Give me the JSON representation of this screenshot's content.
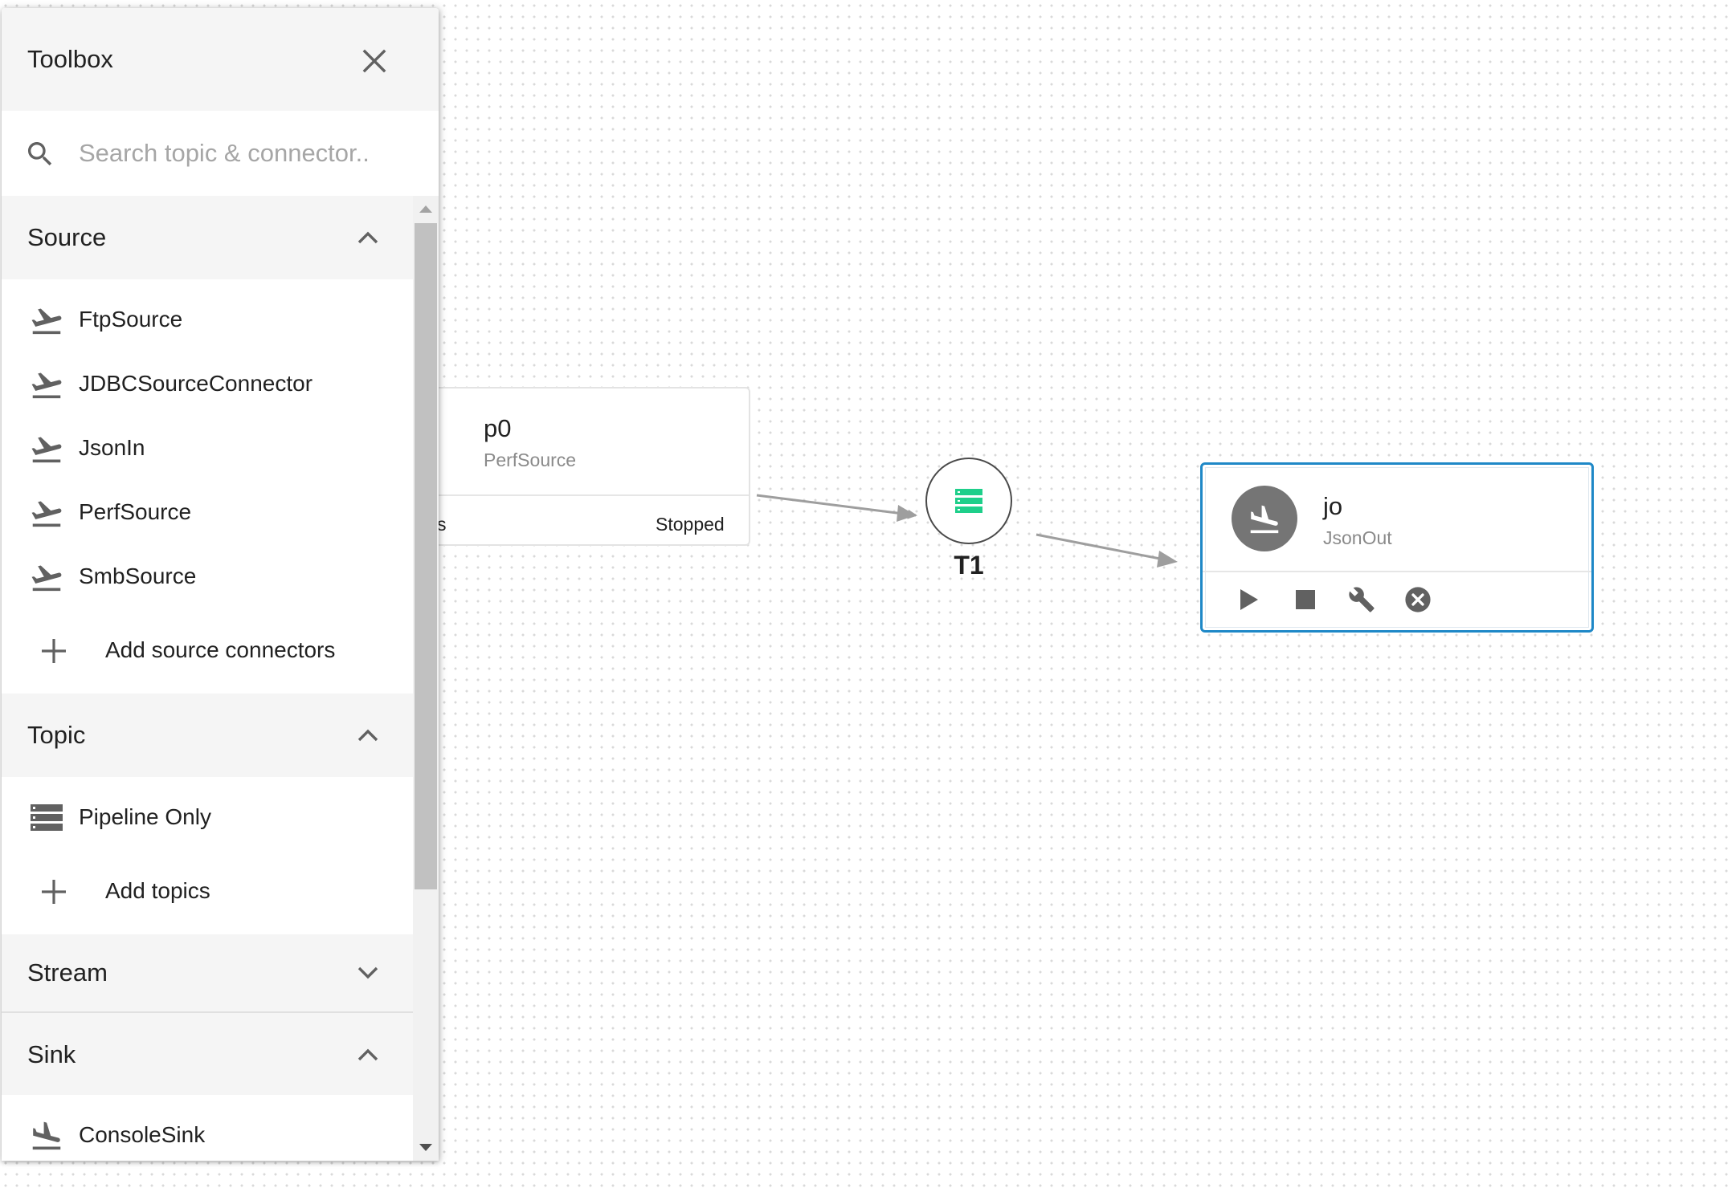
{
  "toolbox": {
    "title": "Toolbox",
    "search_placeholder": "Search topic & connector..",
    "sections": {
      "source": {
        "title": "Source",
        "expanded": true,
        "items": [
          "FtpSource",
          "JDBCSourceConnector",
          "JsonIn",
          "PerfSource",
          "SmbSource"
        ],
        "add_label": "Add source connectors"
      },
      "topic": {
        "title": "Topic",
        "expanded": true,
        "items": [
          "Pipeline Only"
        ],
        "add_label": "Add topics"
      },
      "stream": {
        "title": "Stream",
        "expanded": false
      },
      "sink": {
        "title": "Sink",
        "expanded": true,
        "items": [
          "ConsoleSink"
        ]
      }
    }
  },
  "graph": {
    "source_node": {
      "name": "p0",
      "class_name": "PerfSource",
      "metrics_fragment": "s",
      "status": "Stopped"
    },
    "topic_node": {
      "name": "T1",
      "icon": "topic-stack-icon",
      "icon_color": "#1ecf8a"
    },
    "sink_node": {
      "name": "jo",
      "class_name": "JsonOut",
      "selected": true,
      "actions": [
        "start-icon",
        "stop-icon",
        "configure-icon",
        "delete-icon"
      ]
    }
  },
  "colors": {
    "selection_border": "#1e88c7",
    "avatar": "#757575",
    "edge": "#9e9e9e"
  }
}
